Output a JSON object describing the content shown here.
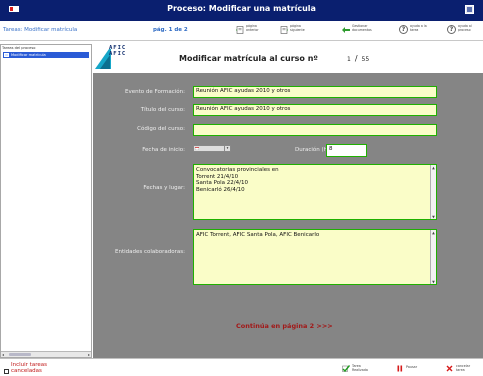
{
  "window": {
    "title": "Proceso: Modificar una matrícula",
    "brand_color": "#0a1f6f"
  },
  "toolbar": {
    "task_label": "Tareas: Modificar matrícula",
    "page_indicator": "pág. 1 de 2",
    "buttons": [
      {
        "label": "página anterior",
        "icon": "prev-page-icon"
      },
      {
        "label": "página siguiente",
        "icon": "next-page-icon"
      },
      {
        "label": "Gestionar documentos",
        "icon": "documents-icon"
      },
      {
        "label": "ayuda a la tarea",
        "icon": "help-icon"
      },
      {
        "label": "ayuda al proceso",
        "icon": "help-icon"
      }
    ]
  },
  "sidebar": {
    "header": "Tareas del proceso",
    "items": [
      {
        "label": "Modificar matrícula",
        "selected": true
      }
    ]
  },
  "form": {
    "logo_text": [
      "AFIC",
      "AFIC"
    ],
    "heading": "Modificar matrícula al curso nº",
    "page_current": "1",
    "page_total": "55",
    "fields": {
      "evento": {
        "label": "Evento de Formación:",
        "value": "Reunión AFIC ayudas 2010 y otros"
      },
      "titulo": {
        "label": "Título del curso:",
        "value": "Reunión AFIC ayudas 2010 y otros"
      },
      "codigo": {
        "label": "Código del curso:",
        "value": ""
      },
      "fecha_inicio": {
        "label": "Fecha de inicio:",
        "value": ""
      },
      "duracion": {
        "label": "Duración (horas):",
        "value": "8"
      },
      "fechas_lugar": {
        "label": "Fechas y lugar:",
        "lines": [
          "Convocatorias provinciales en",
          "Torrent 21/4/10",
          "Santa Pola 22/4/10",
          "Benicarló 26/4/10"
        ]
      },
      "entidades": {
        "label": "Entidades colaboradoras:",
        "lines": [
          "AFIC Torrent, AFIC Santa Pola, AFIC Benicarlo"
        ]
      }
    },
    "continue_link": "Continúa en página 2 >>>"
  },
  "statusbar": {
    "include_cancelled": {
      "label_line1": "Incluir tareas",
      "label_line2": "canceladas",
      "checked": false
    },
    "task_done": {
      "label_line1": "Tarea",
      "label_line2": "Realizada",
      "icon": "check-icon"
    },
    "pause": {
      "label": "Pausar",
      "icon": "pause-icon"
    },
    "cancel": {
      "label_line1": "cancelar",
      "label_line2": "tarea",
      "icon": "cancel-icon"
    }
  }
}
